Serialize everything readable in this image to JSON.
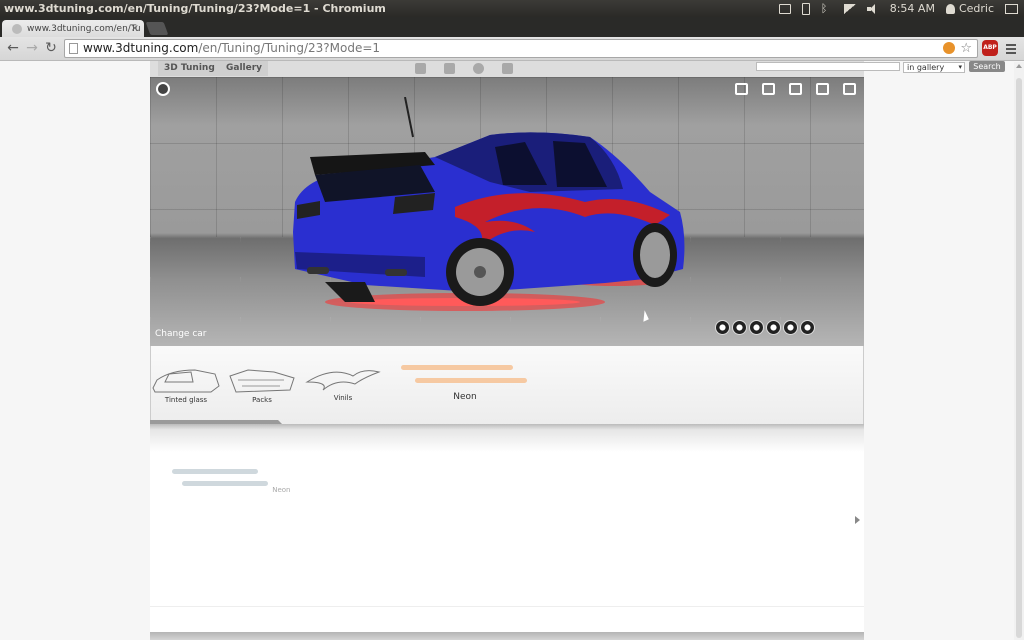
{
  "os": {
    "window_title": "www.3dtuning.com/en/Tuning/Tuning/23?Mode=1 - Chromium",
    "time": "8:54 AM",
    "user": "Cedric"
  },
  "browser": {
    "tab_title": "www.3dtuning.com/en/Tu",
    "tab_close": "×",
    "url_host": "www.3dtuning.com",
    "url_path": "/en/Tuning/Tuning/23?Mode=1",
    "abp_label": "ABP"
  },
  "site": {
    "nav": [
      "3D Tuning",
      "Gallery"
    ],
    "search_scope": "in gallery",
    "search_button": "Search"
  },
  "stage": {
    "change_car": "Change car"
  },
  "parts": [
    {
      "label": "Tinted glass"
    },
    {
      "label": "Packs"
    },
    {
      "label": "Vinils"
    },
    {
      "label": "Neon"
    }
  ],
  "subparts": [
    {
      "label": "Neon"
    }
  ],
  "colors": {
    "car_body": "#2a2fd0",
    "neon": "#ff2a2a",
    "decal": "#c41f2a",
    "neon_icon": "#f2b27a"
  }
}
